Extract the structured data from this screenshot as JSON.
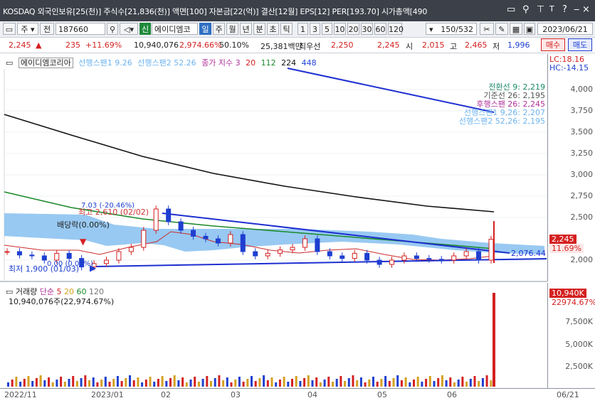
{
  "title_bar": {
    "info": "KOSDAQ 외국인보유[25(천)] 주식수[21,836(천)] 액면[100] 자본금[22(억)] 결산[12월] EPS[12] PER[193.70] 시가총액[490",
    "icons": [
      "window-icon",
      "search-icon",
      "pin-icon",
      "text-icon",
      "help-icon",
      "minimize-icon",
      "maximize-icon",
      "close-icon"
    ]
  },
  "toolbar": {
    "period_dropdown": "주",
    "prev_label": "전",
    "code": "187660",
    "shin_badge": "신",
    "stock_name": "에이디엠코",
    "period_tabs": [
      "일",
      "주",
      "월",
      "년",
      "분",
      "초",
      "틱"
    ],
    "active_period": "일",
    "intervals": [
      "1",
      "3",
      "5",
      "10",
      "20",
      "30",
      "60",
      "120"
    ],
    "page_count": "150/532",
    "date": "2023/06/21"
  },
  "quote": {
    "price": "2,245",
    "arrow": "▲",
    "change": "235",
    "change_pct": "+11.69%",
    "volume": "10,940,076",
    "volume_ratio": "2,974.66%",
    "turnover": "50.10%",
    "trade_value": "25,381백만",
    "best_bid_label": "최우선",
    "best_bid": "2,250",
    "best_ask": "2,245",
    "open_label": "시",
    "open": "2,015",
    "high_label": "고",
    "high": "2,465",
    "low_label": "저",
    "low": "1,996",
    "buy_label": "매수",
    "sell_label": "매도"
  },
  "legend": {
    "name": "에이디엠코리아",
    "span1": "선행스팬1 9.26",
    "span2": "선행스팬2 52.26",
    "ma_label": "종가 지수 3",
    "ma20": "20",
    "ma112": "112",
    "ma224": "224",
    "ma448": "448"
  },
  "ichimoku_box": {
    "conversion": "전환선 9: 2,219",
    "base": "기준선 26: 2,195",
    "lagging": "후행스팬 26: 2,245",
    "leading1": "선행스팬1 9,26: 2,207",
    "leading2": "선행스팬2 52,26: 2,195"
  },
  "annotations": {
    "high_note": "최고 2,610 (02/02)",
    "high_note2": "7.03 (-20.46%)",
    "dividend": "배당락(0.00%)",
    "low_note": "최저 1,900 (01/03)",
    "low_note2": "0.00 (0.03%)",
    "trend_value": "2,076.44",
    "lc": "LC:18.16",
    "hc": "HC:-14.15"
  },
  "price_axis": {
    "ticks": [
      "4,000",
      "3,750",
      "3,500",
      "3,250",
      "3,000",
      "2,750",
      "2,500",
      "2,000"
    ],
    "last_price": "2,245",
    "last_pct": "11.69%"
  },
  "volume_panel": {
    "title": "거래량",
    "simple": "단순",
    "ma5": "5",
    "ma20": "20",
    "ma60": "60",
    "ma120": "120",
    "value_text": "10,940,076주(22,974.67%)",
    "ticks": [
      "7,500K",
      "5,000K",
      "2,500K"
    ],
    "last_volume": "10,940K",
    "last_pct": "22974.67%"
  },
  "x_axis": {
    "labels": [
      "2022/11",
      "2023/01",
      "02",
      "03",
      "04",
      "05",
      "06",
      "06/21"
    ]
  },
  "chart_data": {
    "type": "candlestick",
    "ylim": [
      1800,
      4250
    ],
    "close_approx": [
      2100,
      2060,
      2050,
      2000,
      2080,
      2020,
      1920,
      1960,
      2000,
      2100,
      2150,
      2350,
      2600,
      2450,
      2350,
      2280,
      2250,
      2200,
      2300,
      2100,
      2050,
      2080,
      2120,
      2150,
      2250,
      2100,
      2050,
      2020,
      2080,
      2000,
      1950,
      2000,
      2050,
      2020,
      2010,
      2000,
      2050,
      2100,
      2000,
      2245
    ],
    "volume_last": 10940076,
    "colors": {
      "up": "#d42020",
      "down": "#1e3fd0",
      "ma20": "#cc2a2a",
      "ma224": "#1b8a2b",
      "ma448": "#111111",
      "cloud": "#86bff0",
      "trend": "#1e2fd0"
    }
  }
}
